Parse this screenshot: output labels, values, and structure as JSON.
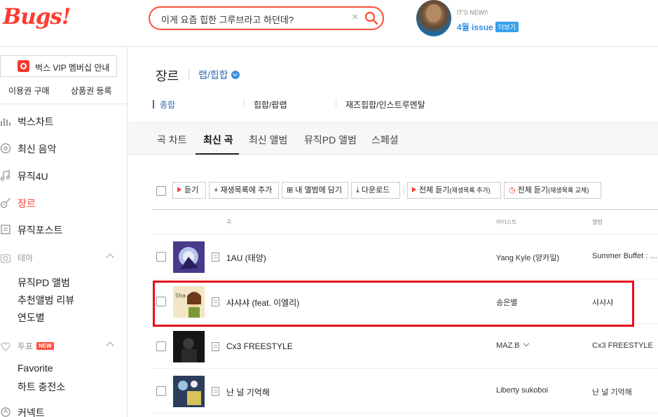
{
  "header": {
    "logo": "Bugs!",
    "search_value": "이게 요즘 힙한 그루브라고 하던데?",
    "promo_small": "IT'S NEW!!",
    "promo_issue": "4월 issue",
    "promo_more": "더보기"
  },
  "sidebar": {
    "vip_label": "벅스 VIP 멤버십 안내",
    "buy_pass": "이용권 구매",
    "gift_register": "상품권 등록",
    "items": [
      {
        "label": "벅스차트",
        "icon": "chart-bars-icon"
      },
      {
        "label": "최신 음악",
        "icon": "disc-icon"
      },
      {
        "label": "뮤직4U",
        "icon": "music-note-icon"
      },
      {
        "label": "장르",
        "icon": "guitar-icon"
      },
      {
        "label": "뮤직포스트",
        "icon": "post-icon"
      }
    ],
    "theme_label": "테마",
    "theme_items": [
      "뮤직PD 앨범",
      "추천앨범 리뷰",
      "연도별"
    ],
    "vote_label": "투표",
    "vote_badge": "NEW",
    "vote_items": [
      "Favorite",
      "하트 충전소"
    ],
    "connect_label": "커넥트"
  },
  "main": {
    "page_title": "장르",
    "genre": "랩/힙합",
    "subtabs": [
      "종합",
      "힙합/팝랩",
      "재즈힙합/인스트루멘탈"
    ],
    "tabs": [
      "곡 차트",
      "최신 곡",
      "최신 앨범",
      "뮤직PD 앨범",
      "스페셜"
    ],
    "toolbar": {
      "listen": "듣기",
      "add_playlist": "재생목록에 추가",
      "add_album": "내 앨범에 담기",
      "download": "다운로드",
      "listen_all_add": "전체 듣기",
      "listen_all_add_sub": "(재생목록 추가)",
      "listen_all_replace": "전체 듣기",
      "listen_all_replace_sub": "(재생목록 교체)"
    },
    "columns": {
      "song": "곡",
      "artist": "아티스트",
      "album": "앨범"
    },
    "rows": [
      {
        "title": "1AU (태양)",
        "artist": "Yang Kyle (양카일)",
        "album": "Summer Buffet : …"
      },
      {
        "title": "샤샤샤 (feat. 이엘리)",
        "artist": "송은별",
        "album": "샤샤샤"
      },
      {
        "title": "Cx3 FREESTYLE",
        "artist": "MAZ.B",
        "album": "Cx3 FREESTYLE"
      },
      {
        "title": "난 널 기억해",
        "artist": "Liberty sukoboi",
        "album": "난 널 기억해"
      }
    ]
  },
  "colors": {
    "brand": "#ff3b2f",
    "accent_blue": "#2e6db0",
    "highlight": "#e3101b"
  }
}
